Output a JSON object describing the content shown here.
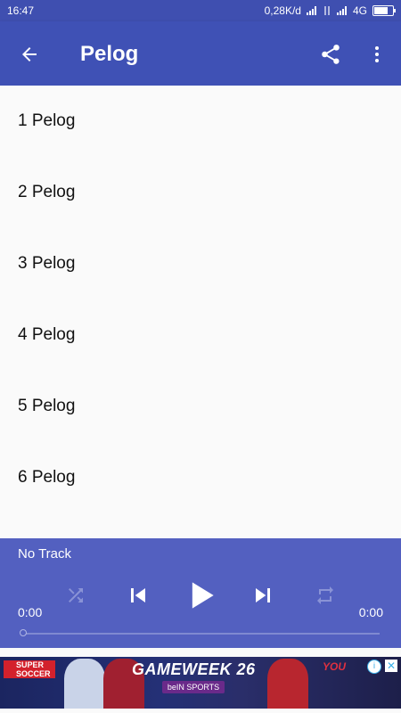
{
  "status_bar": {
    "time": "16:47",
    "network_speed": "0,28K/d",
    "network_type": "4G",
    "icons": [
      "signal-icon",
      "signal-icon",
      "data-transfer-icon",
      "signal-icon",
      "battery-icon"
    ]
  },
  "app_bar": {
    "title": "Pelog",
    "icons": [
      "back-arrow-icon",
      "share-icon",
      "more-vert-icon"
    ],
    "color": "#3f51b5"
  },
  "list": {
    "items": [
      "1 Pelog",
      "2 Pelog",
      "3 Pelog",
      "4 Pelog",
      "5 Pelog",
      "6 Pelog"
    ]
  },
  "player": {
    "track_name": "No Track",
    "elapsed": "0:00",
    "duration": "0:00",
    "progress": 0,
    "controls": [
      "shuffle-icon",
      "skip-previous-icon",
      "play-icon",
      "skip-next-icon",
      "repeat-icon"
    ],
    "color": "#5360c0"
  },
  "ad": {
    "logo_text": "SUPER SOCCER",
    "headline": "GAMEWEEK 26",
    "sponsor": "beIN SPORTS",
    "brand": "YOU",
    "icons": [
      "info-icon",
      "close-icon"
    ]
  }
}
